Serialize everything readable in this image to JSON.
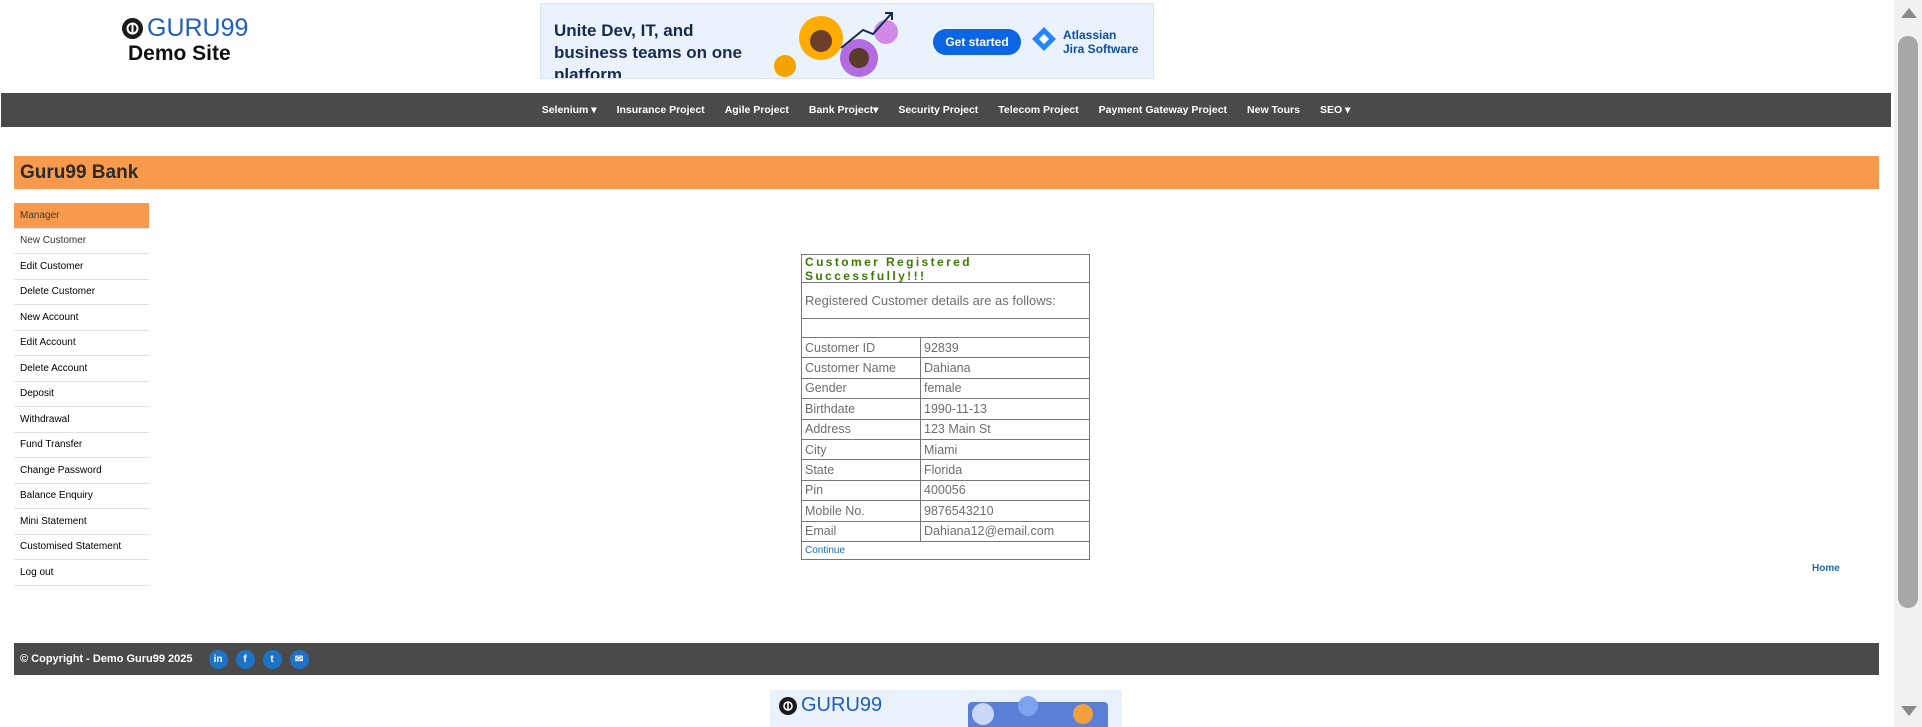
{
  "header": {
    "brand": "GURU99",
    "subtitle": "Demo Site"
  },
  "banner": {
    "headline": "Unite Dev, IT, and business teams on one platform",
    "cta": "Get started",
    "vendor_line1": "Atlassian",
    "vendor_line2": "Jira Software"
  },
  "nav": {
    "items": [
      {
        "label": "Selenium ▾"
      },
      {
        "label": "Insurance Project"
      },
      {
        "label": "Agile Project"
      },
      {
        "label": "Bank Project▾"
      },
      {
        "label": "Security Project"
      },
      {
        "label": "Telecom Project"
      },
      {
        "label": "Payment Gateway Project"
      },
      {
        "label": "New Tours"
      },
      {
        "label": "SEO ▾"
      }
    ]
  },
  "page": {
    "title": "Guru99 Bank"
  },
  "sidebar": {
    "items": [
      {
        "label": "Manager"
      },
      {
        "label": "New Customer"
      },
      {
        "label": "Edit Customer"
      },
      {
        "label": "Delete Customer"
      },
      {
        "label": "New Account"
      },
      {
        "label": "Edit Account"
      },
      {
        "label": "Delete Account"
      },
      {
        "label": "Deposit"
      },
      {
        "label": "Withdrawal"
      },
      {
        "label": "Fund Transfer"
      },
      {
        "label": "Change Password"
      },
      {
        "label": "Balance Enquiry"
      },
      {
        "label": "Mini Statement"
      },
      {
        "label": "Customised Statement"
      },
      {
        "label": "Log out"
      }
    ]
  },
  "result": {
    "heading": "Customer Registered Successfully!!!",
    "subheading": "Registered Customer details are as follows:",
    "rows": [
      {
        "key": "Customer ID",
        "value": "92839"
      },
      {
        "key": "Customer Name",
        "value": "Dahiana"
      },
      {
        "key": "Gender",
        "value": "female"
      },
      {
        "key": "Birthdate",
        "value": "1990-11-13"
      },
      {
        "key": "Address",
        "value": "123 Main St"
      },
      {
        "key": "City",
        "value": "Miami"
      },
      {
        "key": "State",
        "value": "Florida"
      },
      {
        "key": "Pin",
        "value": "400056"
      },
      {
        "key": "Mobile No.",
        "value": "9876543210"
      },
      {
        "key": "Email",
        "value": "Dahiana12@email.com"
      }
    ],
    "continue": "Continue"
  },
  "home_link": "Home",
  "footer": {
    "copyright": "© Copyright - Demo Guru99 2025",
    "social": [
      {
        "icon": "linkedin-icon",
        "glyph": "in"
      },
      {
        "icon": "facebook-icon",
        "glyph": "f"
      },
      {
        "icon": "twitter-icon",
        "glyph": "t"
      },
      {
        "icon": "email-icon",
        "glyph": "✉"
      }
    ]
  },
  "bottom_banner": {
    "brand": "GURU99"
  },
  "colors": {
    "nav_bg": "#4a4a4a",
    "accent_orange": "#f79a4d",
    "success_green": "#3a7a00",
    "link_blue": "#1f6bb0"
  }
}
